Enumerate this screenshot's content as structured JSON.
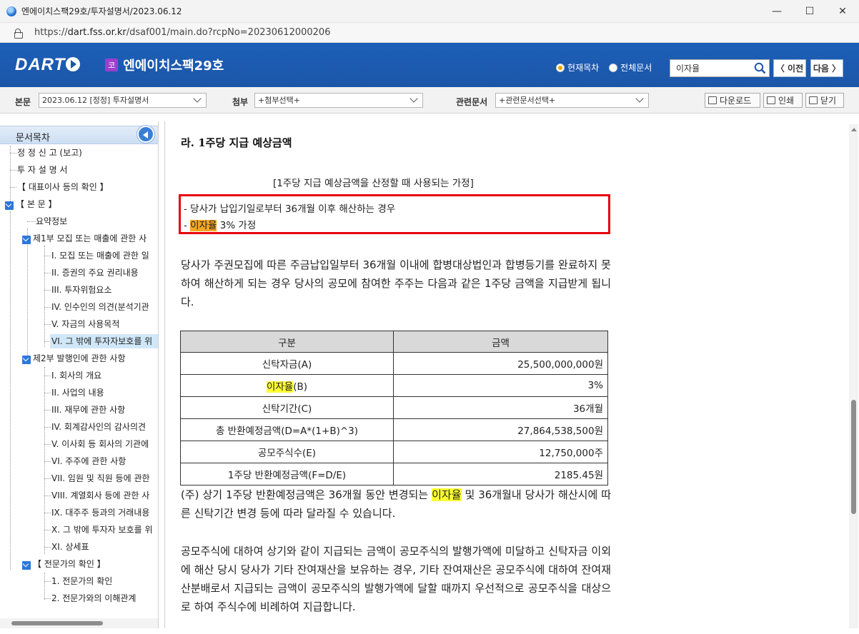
{
  "window": {
    "title": "엔에이치스팩29호/투자설명서/2023.06.12",
    "minimize": "—",
    "maximize": "☐",
    "close": "✕"
  },
  "address": {
    "scheme": "https://",
    "host": "dart.fss.or.kr",
    "path": "/dsaf001/main.do?rcpNo=20230612000206"
  },
  "header": {
    "logo": "DART",
    "corp_badge": "코",
    "corp_name": "엔에이치스팩29호",
    "radio_current": "현재목차",
    "radio_all": "전체문서",
    "search_value": "이자율",
    "prev_label": "〈 이전",
    "next_label": "다음 〉"
  },
  "toolbar": {
    "body_label": "본문",
    "body_select": "2023.06.12 [정정] 투자설명서",
    "attach_label": "첨부",
    "attach_select": "+첨부선택+",
    "related_label": "관련문서",
    "related_select": "+관련문서선택+",
    "download": "다운로드",
    "print": "인쇄",
    "close": "닫기"
  },
  "sidebar": {
    "title": "문서목차",
    "items": [
      "정 정 신 고 (보고)",
      "투 자 설 명 서",
      "【 대표이사 등의 확인 】",
      "【 본 문 】",
      "요약정보",
      "제1부 모집 또는 매출에 관한 사",
      "I. 모집 또는 매출에 관한 일",
      "II. 증권의 주요 권리내용",
      "III. 투자위험요소",
      "IV. 인수인의 의견(분석기관",
      "V. 자금의 사용목적",
      "VI. 그 밖에 투자자보호를 위",
      "제2부 발행인에 관한 사항",
      "I. 회사의 개요",
      "II. 사업의 내용",
      "III. 재무에 관한 사항",
      "IV. 회계감사인의 감사의견",
      "V. 이사회 등 회사의 기관에",
      "VI. 주주에 관한 사항",
      "VII. 임원 및 직원 등에 관한",
      "VIII. 계열회사 등에 관한 사",
      "IX. 대주주 등과의 거래내용",
      "X. 그 밖에 투자자 보호를 위",
      "XI. 상세표",
      "【 전문가의 확인 】",
      "1. 전문가의 확인",
      "2. 전문가와의 이해관계"
    ]
  },
  "content": {
    "section_title": "라. 1주당 지급 예상금액",
    "assume_title": "[1주당 지급 예상금액을 산정할 때 사용되는 가정]",
    "assume_line1": "- 당사가 납입기일로부터 36개월 이후 해산하는 경우",
    "assume_line2_prefix": "- ",
    "assume_line2_hl": "이자율",
    "assume_line2_suffix": " 3% 가정",
    "para1": "당사가 주권모집에 따른 주금납입일부터 36개월 이내에 합병대상법인과 합병등기를 완료하지 못하여 해산하게 되는 경우 당사의 공모에 참여한 주주는 다음과 같은 1주당 금액을 지급받게 됩니다.",
    "table": {
      "headers": [
        "구분",
        "금액"
      ],
      "rows": [
        [
          "신탁자금(A)",
          "25,500,000,000원"
        ],
        [
          "이자율(B)",
          "3%"
        ],
        [
          "신탁기간(C)",
          "36개월"
        ],
        [
          "총 반환예정금액(D=A*(1+B)^3)",
          "27,864,538,500원"
        ],
        [
          "공모주식수(E)",
          "12,750,000주"
        ],
        [
          "1주당 반환예정금액(F=D/E)",
          "2185.45원"
        ]
      ],
      "hl_word": "이자율",
      "row2_suffix": "(B)"
    },
    "note_prefix": "(주) 상기 1주당 반환예정금액은 36개월 동안 변경되는 ",
    "note_hl": "이자율",
    "note_suffix": " 및 36개월내 당사가 해산시에 따른 신탁기간 변경 등에 따라 달라질 수 있습니다.",
    "para2": "공모주식에 대하여 상기와 같이 지급되는 금액이 공모주식의 발행가액에 미달하고 신탁자금 이외에 해산 당시 당사가 기타 잔여재산을 보유하는 경우, 기타 잔여재산은 공모주식에 대하여 잔여재산분배로서 지급되는 금액이 공모주식의 발행가액에 달할 때까지 우선적으로 공모주식을 대상으로 하여 주식수에 비례하여 지급합니다."
  }
}
